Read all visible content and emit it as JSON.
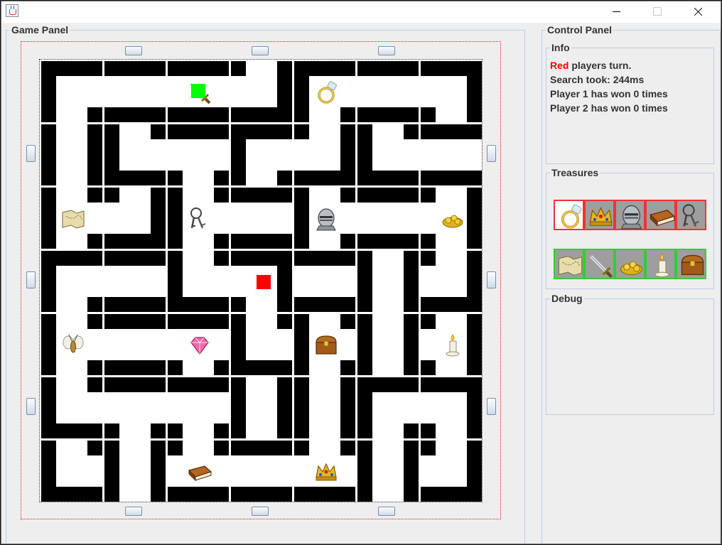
{
  "window": {
    "title": ""
  },
  "game_panel": {
    "title": "Game Panel"
  },
  "control_panel": {
    "title": "Control Panel"
  },
  "info": {
    "title": "Info",
    "turn_color": "Red",
    "turn_suffix": " players turn.",
    "search_time": "Search took: 244ms",
    "player1_wins": "Player 1 has won 0 times",
    "player2_wins": "Player 2 has won 0 times"
  },
  "treasures": {
    "title": "Treasures",
    "red_player": [
      "ring",
      "crown",
      "helmet",
      "book",
      "keys"
    ],
    "green_player": [
      "map",
      "sword",
      "gold",
      "candle",
      "chest"
    ],
    "current_treasure": "ring"
  },
  "debug": {
    "title": "Debug"
  },
  "board": {
    "tiles": [
      [
        {
          "o": "ES"
        },
        {
          "o": "EW"
        },
        {
          "o": "EW",
          "t": "sword"
        },
        {
          "o": "NW"
        },
        {
          "o": "ES",
          "t": "ring"
        },
        {
          "o": "EW"
        },
        {
          "o": "SW"
        }
      ],
      [
        {
          "o": "NS"
        },
        {
          "o": "NE"
        },
        {
          "o": "EWS"
        },
        {
          "o": "ES"
        },
        {
          "o": "NW"
        },
        {
          "o": "NE"
        },
        {
          "o": "EW"
        }
      ],
      [
        {
          "o": "NES",
          "t": "map"
        },
        {
          "o": "NW"
        },
        {
          "o": "NES",
          "t": "keys"
        },
        {
          "o": "EW"
        },
        {
          "o": "NES",
          "t": "helmet"
        },
        {
          "o": "EW"
        },
        {
          "o": "NSW",
          "t": "gold"
        }
      ],
      [
        {
          "o": "ES"
        },
        {
          "o": "EW"
        },
        {
          "o": "NE"
        },
        {
          "o": "SW"
        },
        {
          "o": "EW"
        },
        {
          "o": "NS"
        },
        {
          "o": "NW"
        }
      ],
      [
        {
          "o": "NES",
          "t": "moth"
        },
        {
          "o": "EW"
        },
        {
          "o": "EWS",
          "t": "gem"
        },
        {
          "o": "NE"
        },
        {
          "o": "NES",
          "t": "chest"
        },
        {
          "o": "NS"
        },
        {
          "o": "NSW",
          "t": "candle"
        }
      ],
      [
        {
          "o": "NE"
        },
        {
          "o": "EWS"
        },
        {
          "o": "EWS"
        },
        {
          "o": "NS"
        },
        {
          "o": "NS"
        },
        {
          "o": "ES"
        },
        {
          "o": "SW"
        }
      ],
      [
        {
          "o": "NE"
        },
        {
          "o": "NS"
        },
        {
          "o": "NEW",
          "t": "book"
        },
        {
          "o": "EW"
        },
        {
          "o": "NEW",
          "t": "crown"
        },
        {
          "o": "NS"
        },
        {
          "o": "NW"
        }
      ]
    ],
    "players": [
      {
        "color": "red",
        "row": 3,
        "col": 3
      },
      {
        "color": "green",
        "row": 0,
        "col": 2
      }
    ]
  }
}
